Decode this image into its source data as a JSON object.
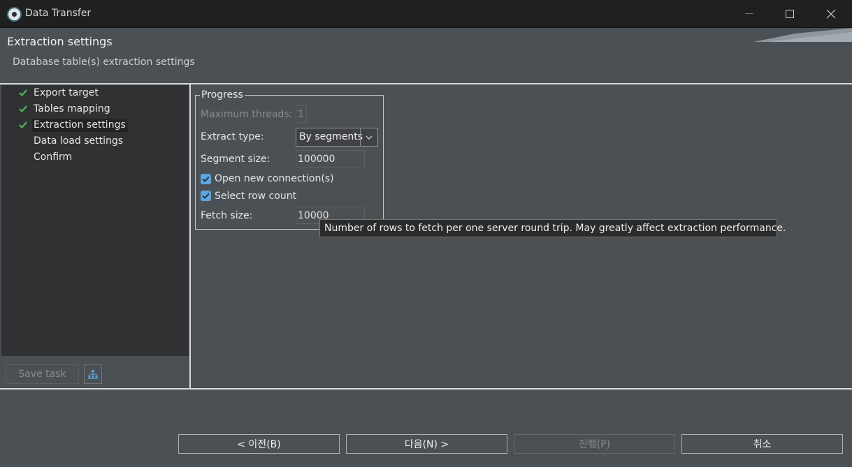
{
  "window": {
    "title": "Data Transfer",
    "controls": [
      "minimize-icon",
      "maximize-icon",
      "close-icon"
    ]
  },
  "header": {
    "title": "Extraction settings",
    "subtitle": "Database table(s) extraction settings"
  },
  "nav": {
    "items": [
      {
        "label": "Export target",
        "done": true,
        "selected": false
      },
      {
        "label": "Tables mapping",
        "done": true,
        "selected": false
      },
      {
        "label": "Extraction settings",
        "done": true,
        "selected": true
      },
      {
        "label": "Data load settings",
        "done": false,
        "selected": false
      },
      {
        "label": "Confirm",
        "done": false,
        "selected": false
      }
    ],
    "save_task": "Save task",
    "tree_icon": "task-tree-icon"
  },
  "progress": {
    "group_title": "Progress",
    "max_threads_label": "Maximum threads:",
    "max_threads_value": "1",
    "extract_type_label": "Extract type:",
    "extract_type_value": "By segments",
    "segment_size_label": "Segment size:",
    "segment_size_value": "100000",
    "open_new_connections_label": "Open new connection(s)",
    "open_new_connections_checked": true,
    "select_row_count_label": "Select row count",
    "select_row_count_checked": true,
    "fetch_size_label": "Fetch size:",
    "fetch_size_value": "10000"
  },
  "tooltip": "Number of rows to fetch per one server round trip. May greatly affect extraction performance.",
  "buttons": {
    "back": "< 이전(B)",
    "next": "다음(N) >",
    "proceed": "진행(P)",
    "cancel": "취소"
  },
  "colors": {
    "accent": "#5aa7e0",
    "check_green": "#4caf50",
    "background": "#4b5054"
  }
}
